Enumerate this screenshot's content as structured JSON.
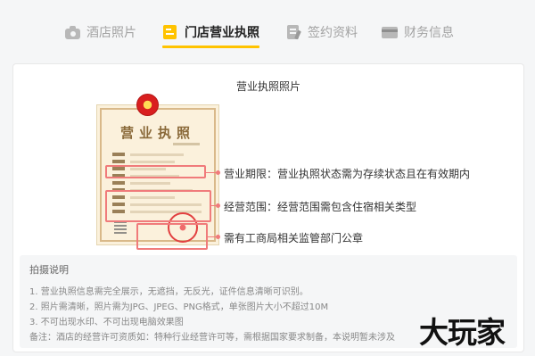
{
  "tabs": [
    {
      "label": "酒店照片",
      "icon": "camera-icon",
      "active": false
    },
    {
      "label": "门店营业执照",
      "icon": "license-icon",
      "active": true
    },
    {
      "label": "签约资料",
      "icon": "contract-icon",
      "active": false
    },
    {
      "label": "财务信息",
      "icon": "card-icon",
      "active": false
    }
  ],
  "panel": {
    "title": "营业执照照片",
    "license_sample": {
      "title": "营业执照"
    },
    "annotations": [
      "营业期限：营业执照状态需为存续状态且在有效期内",
      "经营范围：经营范围需包含住宿相关类型",
      "需有工商局相关监管部门公章"
    ]
  },
  "tips": {
    "title": "拍摄说明",
    "items": [
      "1. 营业执照信息需完全展示，无遮挡，无反光，证件信息清晰可识别。",
      "2. 照片需清晰，照片需为JPG、JPEG、PNG格式，单张图片大小不超过10M",
      "3. 不可出现水印、不可出现电脑效果图",
      "备注：酒店的经营许可资质如：特种行业经营许可等，需根据国家要求制备，本说明暂未涉及"
    ]
  },
  "watermark": "大玩家",
  "colors": {
    "accent": "#ffc300",
    "highlight": "#f07b7b",
    "inactive_tab": "#a3a3a3"
  }
}
